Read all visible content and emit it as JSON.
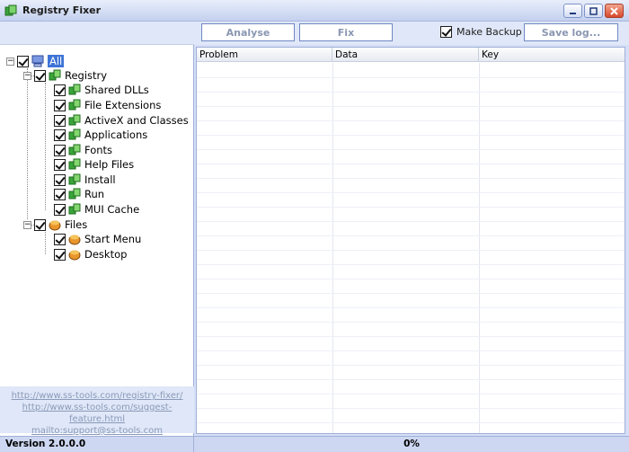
{
  "window": {
    "title": "Registry Fixer"
  },
  "toolbar": {
    "analyse_label": "Analyse",
    "fix_label": "Fix",
    "make_backup_label": "Make Backup",
    "make_backup_checked": true,
    "save_log_label": "Save log..."
  },
  "tree": {
    "root": {
      "label": "All",
      "checked": true
    },
    "registry": {
      "label": "Registry",
      "checked": true,
      "items": [
        {
          "label": "Shared DLLs",
          "checked": true
        },
        {
          "label": "File Extensions",
          "checked": true
        },
        {
          "label": "ActiveX and Classes",
          "checked": true
        },
        {
          "label": "Applications",
          "checked": true
        },
        {
          "label": "Fonts",
          "checked": true
        },
        {
          "label": "Help Files",
          "checked": true
        },
        {
          "label": "Install",
          "checked": true
        },
        {
          "label": "Run",
          "checked": true
        },
        {
          "label": "MUI Cache",
          "checked": true
        }
      ]
    },
    "files": {
      "label": "Files",
      "checked": true,
      "items": [
        {
          "label": "Start Menu",
          "checked": true
        },
        {
          "label": "Desktop",
          "checked": true
        }
      ]
    }
  },
  "links": [
    "http://www.ss-tools.com/registry-fixer/",
    "http://www.ss-tools.com/suggest-feature.html",
    "mailto:support@ss-tools.com"
  ],
  "grid": {
    "columns": [
      "Problem",
      "Data",
      "Key"
    ]
  },
  "status": {
    "version": "Version 2.0.0.0",
    "progress": "0%"
  },
  "colors": {
    "selection": "#3f74d6",
    "panel": "#dfe7f8",
    "border": "#9fb0d8"
  }
}
